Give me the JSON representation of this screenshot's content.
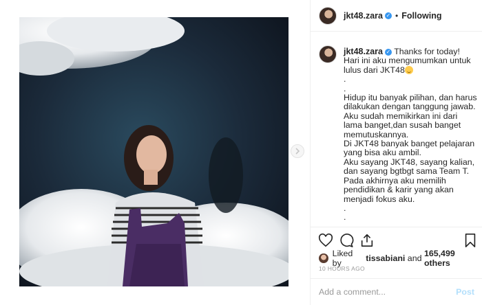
{
  "post": {
    "username": "jkt48.zara",
    "follow_status": "Following",
    "separator": "•",
    "verified_mark": "✓",
    "caption_lines": [
      "Thanks for today!",
      "Hari ini aku mengumumkan untuk",
      "lulus dari JKT48",
      ".",
      ".",
      "Hidup itu banyak pilihan, dan harus",
      "dilakukan dengan tanggung jawab.",
      "Aku sudah memikirkan ini dari",
      "lama banget,dan susah banget",
      "memutuskannya.",
      "Di JKT48 banyak banget pelajaran",
      "yang bisa aku ambil.",
      "Aku sayang JKT48, sayang kalian,",
      "dan sayang bgtbgt sama Team T.",
      "Pada akhirnya aku memilih",
      "pendidikan & karir yang akan",
      "menjadi fokus aku.",
      ".",
      "."
    ],
    "likes_prefix": "Liked by",
    "liked_by_user": "tissabiani",
    "likes_conjunction": "and",
    "likes_others": "165,499 others",
    "time_ago": "10 HOURS AGO",
    "comment_placeholder": "Add a comment...",
    "post_label": "Post"
  },
  "icons": {
    "like": "heart-icon",
    "comment": "comment-icon",
    "share": "share-icon",
    "save": "bookmark-icon",
    "next": "chevron-right-icon",
    "emoji": "smiling-face-emoji"
  },
  "colors": {
    "verified": "#3897f0",
    "post_button": "#b2dffc",
    "muted_text": "#999999",
    "border": "#efefef"
  }
}
